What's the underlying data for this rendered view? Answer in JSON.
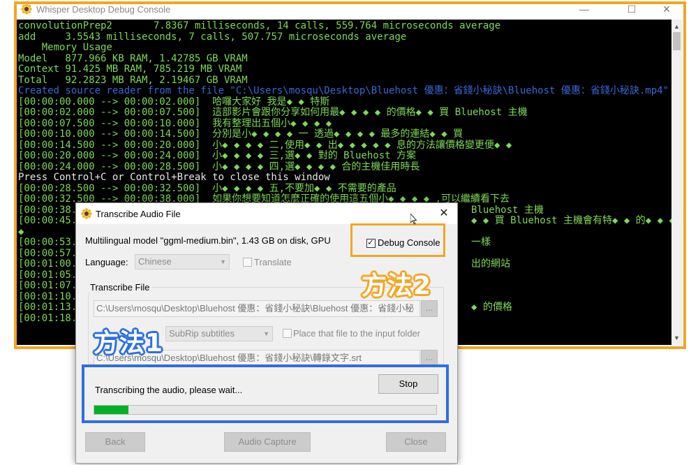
{
  "console": {
    "title": "Whisper Desktop Debug Console",
    "controls": {
      "minimize": "—",
      "maximize": "☐",
      "close": "✕"
    },
    "lines": [
      {
        "text": "convolutionPrep2       7.8367 milliseconds, 14 calls, 559.764 microseconds average",
        "color": "green"
      },
      {
        "text": "add     3.5543 milliseconds, 7 calls, 507.757 microseconds average",
        "color": "green"
      },
      {
        "text": "    Memory Usage",
        "color": "green"
      },
      {
        "text": "Model   877.966 KB RAM, 1.42785 GB VRAM",
        "color": "green"
      },
      {
        "text": "Context 91.425 MB RAM, 785.219 MB VRAM",
        "color": "green"
      },
      {
        "text": "Total   92.2823 MB RAM, 2.19467 GB VRAM",
        "color": "green"
      },
      {
        "text": "Created source reader from the file \"C:\\Users\\mosqu\\Desktop\\Bluehost 優惠：省錢小秘訣\\Bluehost 優惠：省錢小秘訣.mp4\"",
        "color": "blue"
      },
      {
        "text": "[00:00:00.000 --> 00:00:02.000]  哈囉大家好 我是◆ ◆ 特斯",
        "color": "green"
      },
      {
        "text": "[00:00:02.000 --> 00:00:07.500]  這部影片會跟你分享如何用最◆ ◆ ◆ ◆ 的價格◆ ◆ 買 Bluehost 主機",
        "color": "green"
      },
      {
        "text": "[00:00:07.500 --> 00:00:10.000]  我有整理出五個小◆ ◆ ◆ ◆",
        "color": "green"
      },
      {
        "text": "[00:00:10.000 --> 00:00:14.500]  分別是小◆ ◆ ◆ ◆ 一 透過◆ ◆ ◆ ◆ 最多的連結◆ ◆ 買",
        "color": "green"
      },
      {
        "text": "[00:00:14.500 --> 00:00:20.000]  小◆ ◆ ◆ ◆ 二,使用◆ ◆ 出◆ ◆ ◆ ◆ ◆ 息的方法讓價格變更便◆ ◆",
        "color": "green"
      },
      {
        "text": "[00:00:20.000 --> 00:00:24.000]  小◆ ◆ ◆ ◆ 三,選◆ ◆ 對的 Bluehost 方案",
        "color": "green"
      },
      {
        "text": "[00:00:24.000 --> 00:00:28.500]  小◆ ◆ ◆ ◆ 四,選◆ ◆ ◆ ◆ 合的主機佳用時長",
        "color": "green"
      },
      {
        "text": "Press Control+C or Control+Break to close this window",
        "color": "white"
      },
      {
        "text": "[00:00:28.500 --> 00:00:32.500]  小◆ ◆ ◆ ◆ 五,不要加◆ ◆ 不需要的產品",
        "color": "green"
      },
      {
        "text": "[00:00:32.500 --> 00:00:38.000]  如果你想要知道怎麼正確的使用這五個小◆ ◆ ◆ ◆ ,可以繼續看下去",
        "color": "green"
      },
      {
        "text": "[00:00:38.000 --> 00:00:45.000]                                              Bluehost 主機",
        "color": "green"
      },
      {
        "text": "[00:00:45.000 --> 00:00:53.000]                                              ◆ ◆ 買 Bluehost 主機會有特◆ ◆ 的◆ ◆ ◆",
        "color": "green"
      },
      {
        "text": "◆",
        "color": "green"
      },
      {
        "text": "[00:00:53.000 --> 00:00:57.000]                                              一樣",
        "color": "green"
      },
      {
        "text": "[00:00:57.000 --> 00:01:00.000]",
        "color": "green"
      },
      {
        "text": "[00:01:00.000 --> 00:01:05.500]                                              出的網站",
        "color": "green"
      },
      {
        "text": "[00:01:05.500 --> 00:01:07.500]",
        "color": "green"
      },
      {
        "text": "[00:01:07.500 --> 00:01:10.500]",
        "color": "green"
      },
      {
        "text": "[00:01:10.500 --> 00:01:13.500]",
        "color": "green"
      },
      {
        "text": "[00:01:13.500 --> 00:01:18.000]                                              ◆ 的價格",
        "color": "green"
      },
      {
        "text": "[00:01:18.000 --> 00:01:22.500]",
        "color": "green"
      }
    ]
  },
  "dialog": {
    "title": "Transcribe Audio File",
    "close": "✕",
    "model_info": "Multilingual model \"ggml-medium.bin\", 1.43 GB on disk, GPU",
    "debug_console_label": "Debug Console",
    "debug_console_checked": true,
    "language_label": "Language:",
    "language_value": "Chinese",
    "translate_label": "Translate",
    "translate_checked": false,
    "transcribe_file_group": "Transcribe File",
    "input_path": "C:\\Users\\mosqu\\Desktop\\Bluehost 優惠：省錢小秘訣\\Bluehost 優惠：省錢小秘",
    "browse_label": "...",
    "output_format": "SubRip subtitles",
    "place_label": "Place that file to the input folder",
    "place_checked": false,
    "output_path": "C:\\Users\\mosqu\\Desktop\\Bluehost 優惠：省錢小秘訣\\轉錄文字.srt",
    "status": "Transcribing the audio, please wait...",
    "stop_label": "Stop",
    "progress": 0.1,
    "back_label": "Back",
    "audio_capture_label": "Audio Capture",
    "close_label": "Close"
  },
  "annotations": {
    "method1": "方法1",
    "method2": "方法2",
    "orange": "#f2a624",
    "blue": "#2f6fe0"
  }
}
